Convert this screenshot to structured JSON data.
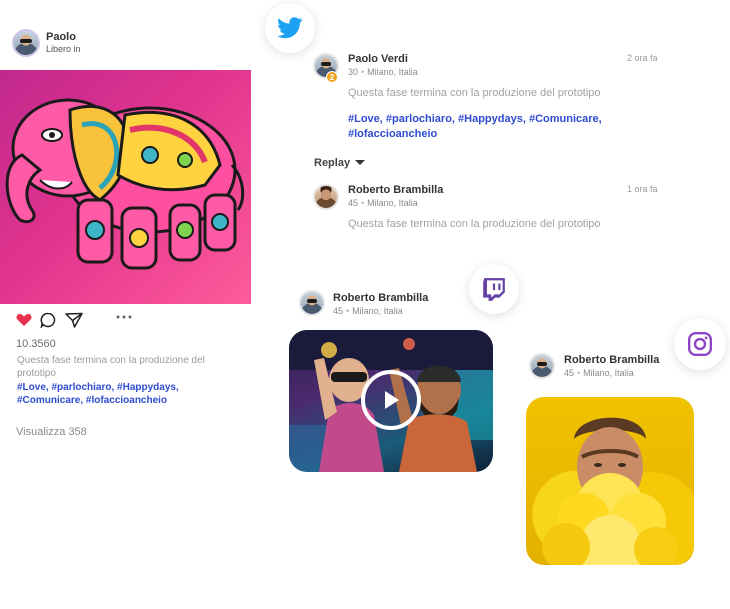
{
  "instagram_post": {
    "user_name": "Paolo",
    "user_status": "Libero in",
    "likes": "10.3560",
    "caption": "Questa fase termina con la produzione del prototipo",
    "hashtags_line1": "#Love, #parlochiaro, #Happydays,",
    "hashtags_line2": "#Comunicare, #lofaccioancheio",
    "views": "Visualizza 358",
    "colors": {
      "like": "#e6334f",
      "tags": "#2f4bd1"
    }
  },
  "twitter_thread": {
    "post": {
      "user_name": "Paolo Verdi",
      "age": "30",
      "location": "Milano, Italia",
      "time": "2 ora fa",
      "badge": "2",
      "text": "Questa fase termina con la produzione del prototipo",
      "hashtags_line1": "#Love, #parlochiaro, #Happydays, #Comunicare,",
      "hashtags_line2": "#lofaccioancheio"
    },
    "replay_label": "Replay",
    "reply": {
      "user_name": "Roberto Brambilla",
      "age": "45",
      "location": "Milano, Italia",
      "time": "1 ora fa",
      "text": "Questa fase termina con la produzione del prototipo"
    },
    "brand_color": "#1da1f2"
  },
  "twitch_post": {
    "user_name": "Roberto Brambilla",
    "age": "45",
    "location": "Milano, Italia",
    "brand_color": "#6441a5"
  },
  "instagram_photo_post": {
    "user_name": "Roberto Brambilla",
    "age": "45",
    "location": "Milano, Italia",
    "brand_color": "#8e44c4"
  },
  "icons": [
    "twitter-icon",
    "twitch-icon",
    "instagram-icon",
    "heart-icon",
    "comment-icon",
    "share-icon",
    "more-icon",
    "play-icon",
    "chevron-down-icon"
  ]
}
